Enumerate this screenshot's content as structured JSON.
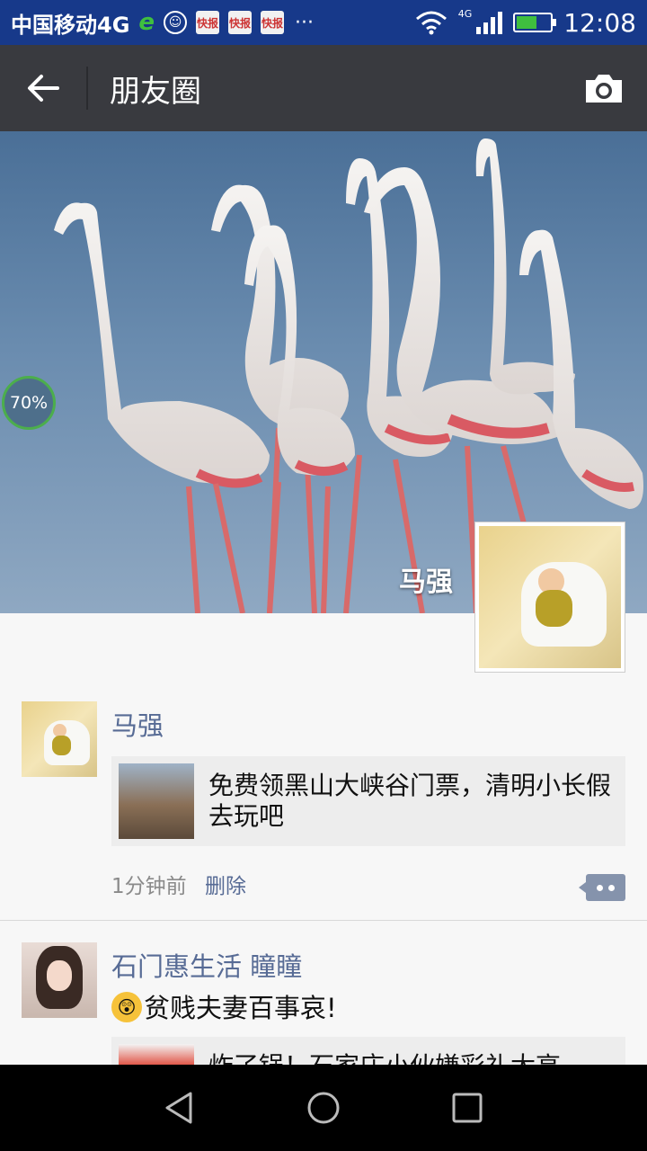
{
  "status_bar": {
    "carrier": "中国移动4G",
    "network_label": "4G",
    "time": "12:08",
    "battery_level": 0.6,
    "more": "···",
    "news_icon_text": "快报"
  },
  "app_bar": {
    "title": "朋友圈"
  },
  "cover": {
    "user_name": "马强",
    "upload_progress": "70%"
  },
  "posts": [
    {
      "name": "马强",
      "link_title": "免费领黑山大峡谷门票，清明小长假去玩吧",
      "time": "1分钟前",
      "delete_label": "删除"
    },
    {
      "name": "石门惠生活  瞳瞳",
      "text": "贫贱夫妻百事哀!",
      "emoji": "😲",
      "link_title": "炸了锅！石家庄小伙嫌彩礼太高"
    }
  ],
  "colors": {
    "status_bar_bg": "#17398a",
    "app_bar_bg": "#393a3f",
    "link_name": "#576b95",
    "feed_bg": "#f7f7f7"
  }
}
